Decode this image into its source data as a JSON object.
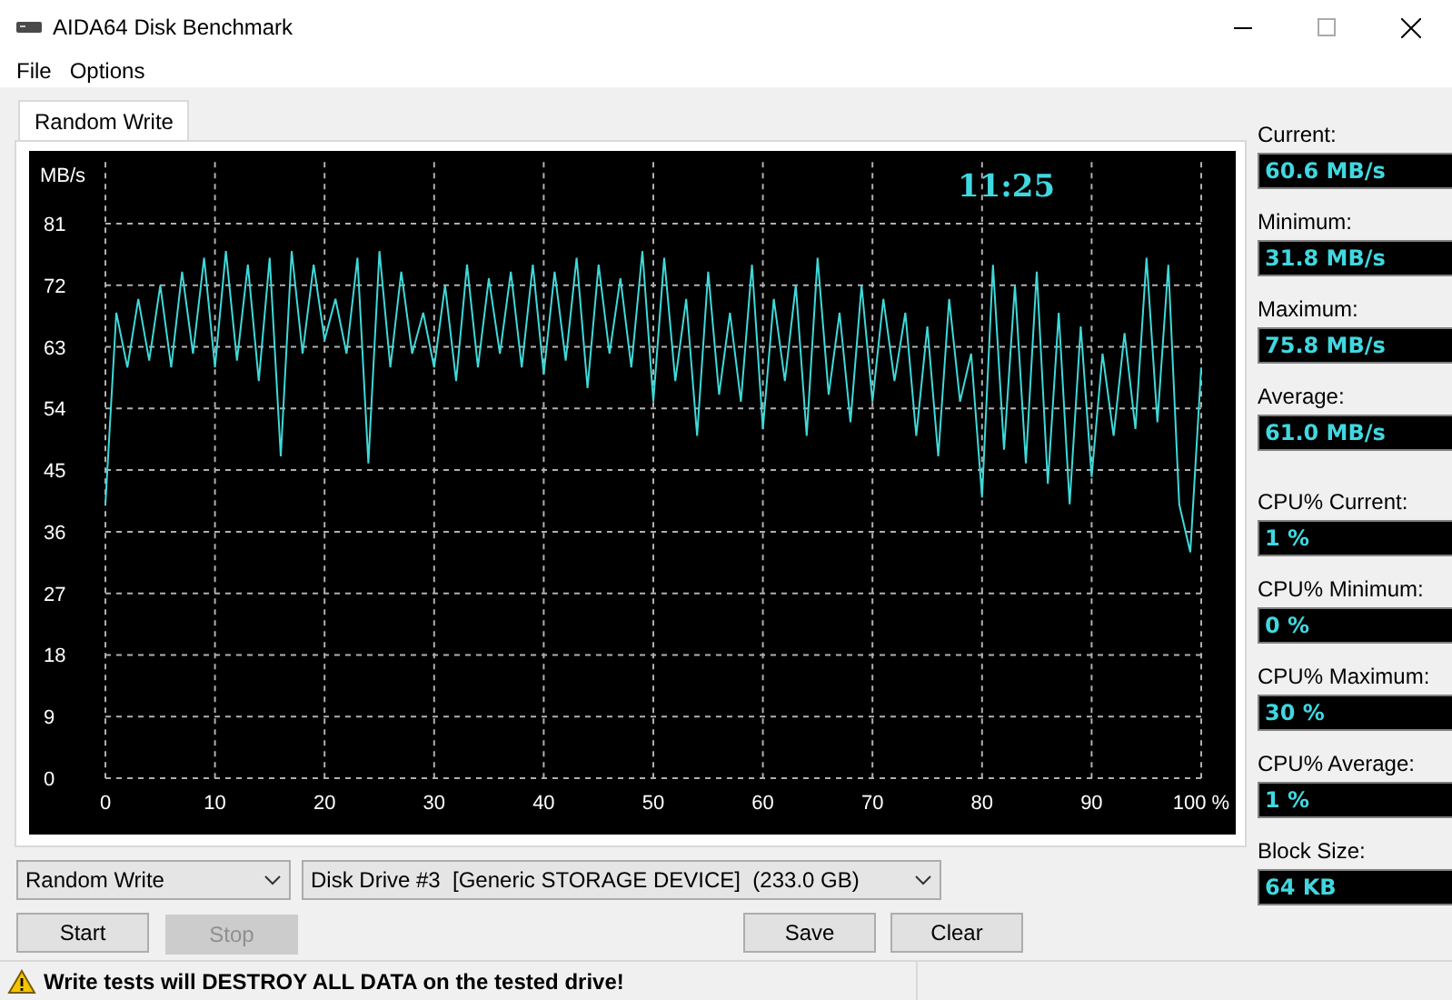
{
  "window": {
    "title": "AIDA64 Disk Benchmark"
  },
  "menu": [
    "File",
    "Options"
  ],
  "tabs": [
    {
      "label": "Random Write",
      "selected": true
    }
  ],
  "chart": {
    "elapsed_time": "11:25",
    "chart_data": {
      "type": "line",
      "ylabel": "MB/s",
      "grid": true,
      "xlim": [
        0,
        100
      ],
      "ylim": [
        0,
        90
      ],
      "x": [
        0,
        1,
        2,
        3,
        4,
        5,
        6,
        7,
        8,
        9,
        10,
        11,
        12,
        13,
        14,
        15,
        16,
        17,
        18,
        19,
        20,
        21,
        22,
        23,
        24,
        25,
        26,
        27,
        28,
        29,
        30,
        31,
        32,
        33,
        34,
        35,
        36,
        37,
        38,
        39,
        40,
        41,
        42,
        43,
        44,
        45,
        46,
        47,
        48,
        49,
        50,
        51,
        52,
        53,
        54,
        55,
        56,
        57,
        58,
        59,
        60,
        61,
        62,
        63,
        64,
        65,
        66,
        67,
        68,
        69,
        70,
        71,
        72,
        73,
        74,
        75,
        76,
        77,
        78,
        79,
        80,
        81,
        82,
        83,
        84,
        85,
        86,
        87,
        88,
        89,
        90,
        91,
        92,
        93,
        94,
        95,
        96,
        97,
        98,
        99,
        100
      ],
      "yticks": [
        0,
        9,
        18,
        27,
        36,
        45,
        54,
        63,
        72,
        81
      ],
      "xticks": [
        0,
        10,
        20,
        30,
        40,
        50,
        60,
        70,
        80,
        90,
        {
          "value": 100,
          "label": "100 %"
        }
      ],
      "series": [
        {
          "color": "#40d8d8",
          "values": [
            40,
            68,
            60,
            70,
            61,
            72,
            60,
            74,
            62,
            76,
            60,
            77,
            61,
            75,
            58,
            76,
            47,
            77,
            62,
            75,
            64,
            70,
            62,
            76,
            46,
            77,
            60,
            74,
            62,
            68,
            60,
            72,
            58,
            75,
            60,
            73,
            62,
            74,
            60,
            75,
            59,
            74,
            61,
            76,
            57,
            75,
            62,
            73,
            60,
            77,
            55,
            76,
            58,
            70,
            50,
            74,
            56,
            68,
            55,
            75,
            51,
            70,
            58,
            72,
            50,
            76,
            56,
            68,
            52,
            72,
            55,
            70,
            58,
            68,
            50,
            66,
            47,
            70,
            55,
            62,
            41,
            75,
            48,
            72,
            46,
            74,
            43,
            68,
            40,
            66,
            44,
            62,
            50,
            65,
            51,
            76,
            52,
            75,
            40,
            33,
            60
          ]
        }
      ]
    }
  },
  "transfer_stats": [
    {
      "label": "Current:",
      "value": "60.6 MB/s"
    },
    {
      "label": "Minimum:",
      "value": "31.8 MB/s"
    },
    {
      "label": "Maximum:",
      "value": "75.8 MB/s"
    },
    {
      "label": "Average:",
      "value": "61.0 MB/s"
    }
  ],
  "cpu_stats": [
    {
      "label": "CPU% Current:",
      "value": "1 %"
    },
    {
      "label": "CPU% Minimum:",
      "value": "0 %"
    },
    {
      "label": "CPU% Maximum:",
      "value": "30 %"
    },
    {
      "label": "CPU% Average:",
      "value": "1 %"
    }
  ],
  "block_size": {
    "label": "Block Size:",
    "value": "64 KB"
  },
  "test_select": {
    "value": "Random Write"
  },
  "drive_select": {
    "value": "Disk Drive #3  [Generic STORAGE DEVICE]  (233.0 GB)"
  },
  "buttons": [
    {
      "label": "Start",
      "disabled": false
    },
    {
      "label": "Stop",
      "disabled": true
    },
    {
      "label": "Save",
      "disabled": false
    },
    {
      "label": "Clear",
      "disabled": false
    }
  ],
  "status_bar": {
    "message": "Write tests will DESTROY ALL DATA on the tested drive!"
  }
}
